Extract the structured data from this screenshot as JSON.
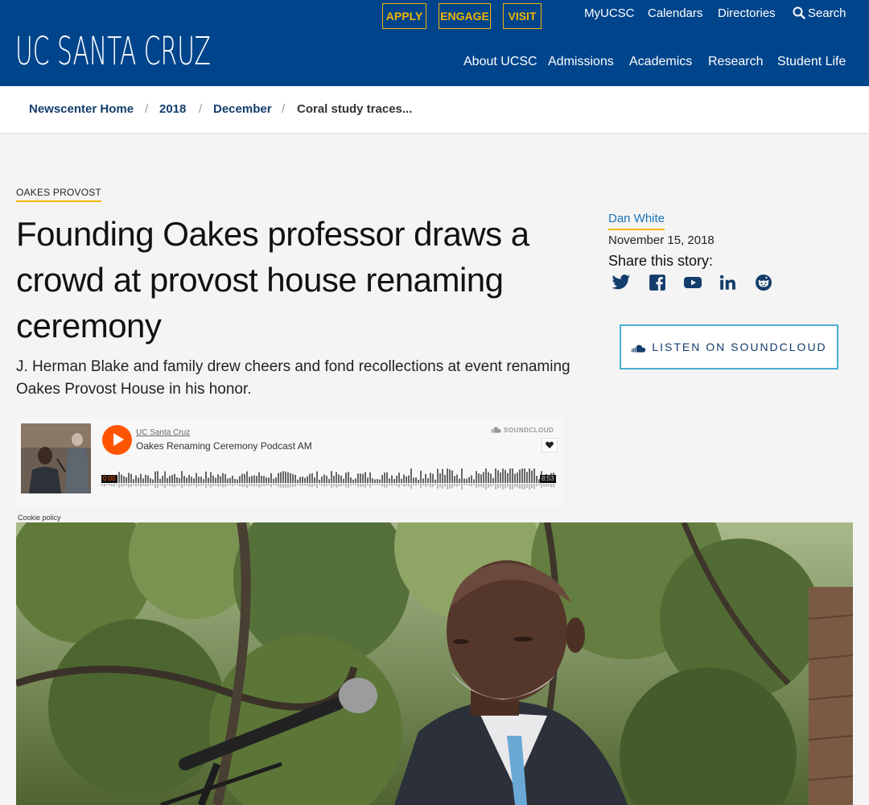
{
  "header": {
    "logo_text": "UC SANTA CRUZ",
    "cta": {
      "apply": "APPLY",
      "engage": "ENGAGE",
      "visit": "VISIT"
    },
    "utility": {
      "myucsc": "MyUCSC",
      "calendars": "Calendars",
      "directories": "Directories",
      "search": "Search"
    },
    "nav": {
      "about": "About UCSC",
      "admissions": "Admissions",
      "academics": "Academics",
      "research": "Research",
      "student_life": "Student Life"
    },
    "colors": {
      "brand_blue": "#00458c",
      "accent_gold": "#f2b500"
    }
  },
  "breadcrumb": {
    "items": [
      "Newscenter Home",
      "2018",
      "December",
      "Coral study traces..."
    ],
    "separator": "/"
  },
  "article": {
    "category": "OAKES PROVOST",
    "headline": "Founding Oakes professor draws a crowd at provost house renaming ceremony",
    "subhead": "J. Herman Blake and family drew cheers and fond recollections at event renaming Oakes Provost House in his honor."
  },
  "sidebar": {
    "author": "Dan White",
    "date": "November 15, 2018",
    "share_label": "Share this story:",
    "share_icons": [
      "twitter-icon",
      "facebook-icon",
      "youtube-icon",
      "linkedin-icon",
      "reddit-icon"
    ],
    "soundcloud_button": "LISTEN ON SOUNDCLOUD"
  },
  "soundcloud_embed": {
    "user": "UC Santa Cruz",
    "track": "Oakes Renaming Ceremony Podcast AM",
    "brand": "SOUNDCLOUD",
    "time_start": "0:00",
    "time_end": "8:53",
    "cookie_policy": "Cookie policy",
    "accent": "#ff5500"
  }
}
